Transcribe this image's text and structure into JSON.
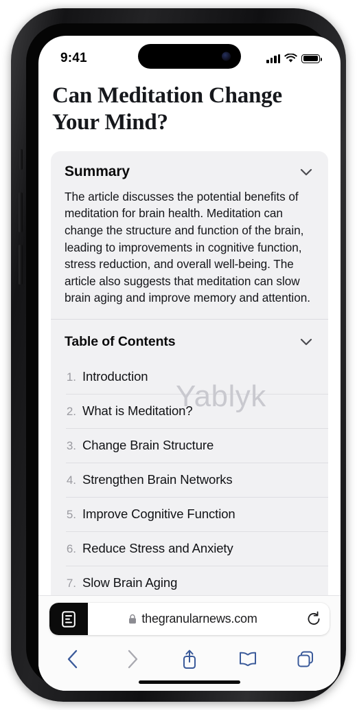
{
  "status_bar": {
    "time": "9:41",
    "signal_icon": "cellular-bars-icon",
    "wifi_icon": "wifi-icon",
    "battery_icon": "battery-full-icon"
  },
  "article": {
    "title": "Can Meditation Change Your Mind?"
  },
  "summary_card": {
    "heading": "Summary",
    "collapse_icon": "chevron-down-icon",
    "text": "The article discusses the potential benefits of meditation for brain health. Meditation can change the structure and function of the brain, leading to improvements in cognitive function, stress reduction, and overall well-being. The article also suggests that meditation can slow brain aging and improve memory and attention."
  },
  "table_of_contents": {
    "heading": "Table of Contents",
    "collapse_icon": "chevron-down-icon",
    "items": [
      {
        "number": "1.",
        "label": "Introduction"
      },
      {
        "number": "2.",
        "label": "What is Meditation?"
      },
      {
        "number": "3.",
        "label": "Change Brain Structure"
      },
      {
        "number": "4.",
        "label": "Strengthen Brain Networks"
      },
      {
        "number": "5.",
        "label": "Improve Cognitive Function"
      },
      {
        "number": "6.",
        "label": "Reduce Stress and Anxiety"
      },
      {
        "number": "7.",
        "label": "Slow Brain Aging"
      }
    ]
  },
  "watermark": {
    "text": "Yablyk"
  },
  "browser": {
    "address_bar": {
      "reader_icon": "reader-mode-icon",
      "lock_icon": "lock-icon",
      "url": "thegranularnews.com",
      "reload_icon": "reload-icon"
    },
    "toolbar": {
      "back_icon": "chevron-left-icon",
      "forward_icon": "chevron-right-icon",
      "share_icon": "share-icon",
      "bookmarks_icon": "book-icon",
      "tabs_icon": "tabs-icon"
    }
  },
  "colors": {
    "accent_blue": "#3a5a9a",
    "disabled_grey": "#a9a9b0",
    "card_bg": "#f1f1f3",
    "reader_active_bg": "#0b0b0b"
  }
}
